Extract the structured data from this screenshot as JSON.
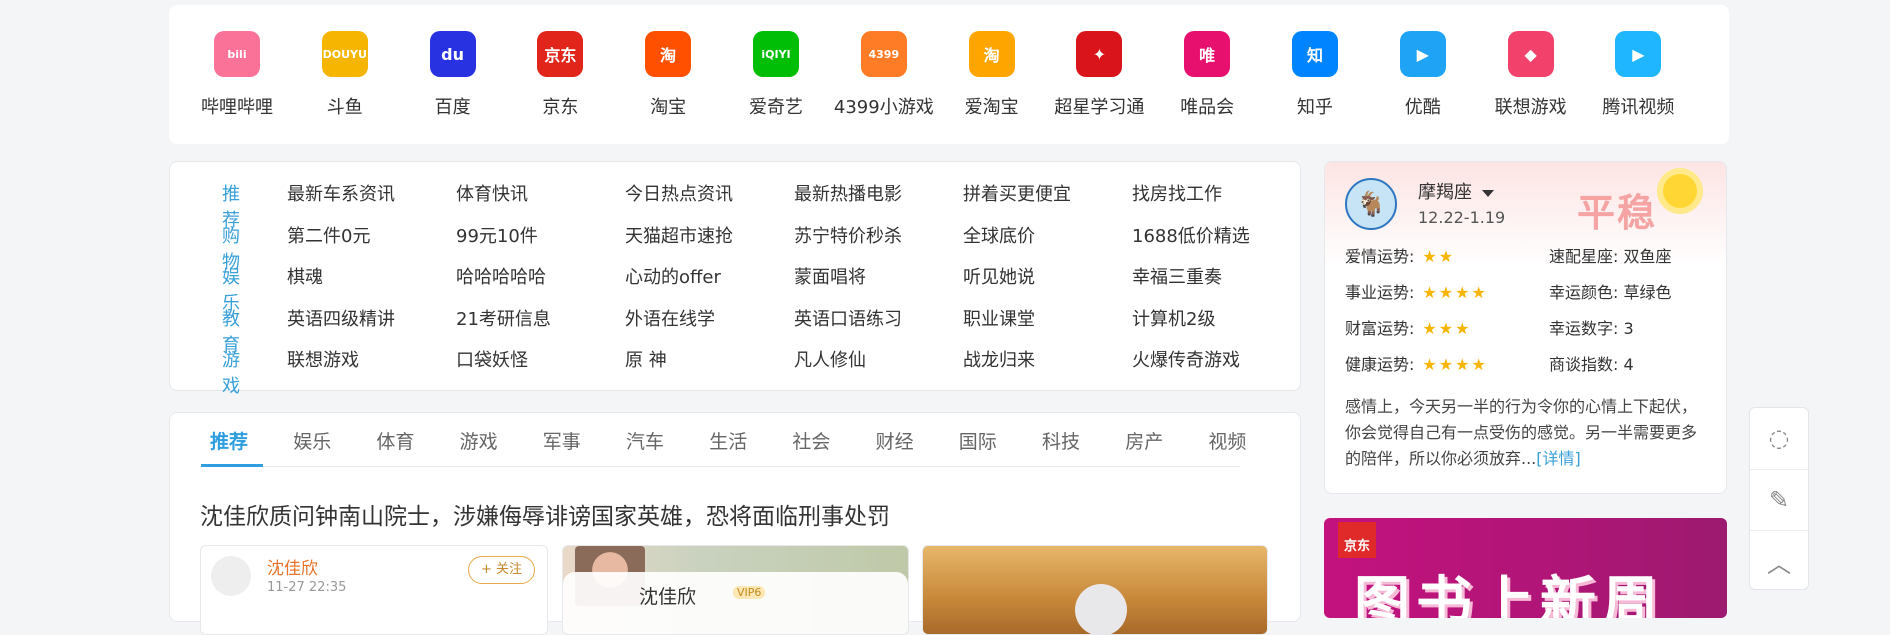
{
  "apps": [
    {
      "label": "哔哩哔哩",
      "icon": "bilibili-icon",
      "glyph": "bili",
      "color": "#fb7299"
    },
    {
      "label": "斗鱼",
      "icon": "douyu-icon",
      "glyph": "DOUYU",
      "color": "#f5b500"
    },
    {
      "label": "百度",
      "icon": "baidu-icon",
      "glyph": "du",
      "color": "#2932e1"
    },
    {
      "label": "京东",
      "icon": "jd-icon",
      "glyph": "京东",
      "color": "#e1251b"
    },
    {
      "label": "淘宝",
      "icon": "taobao-icon",
      "glyph": "淘",
      "color": "#ff5000"
    },
    {
      "label": "爱奇艺",
      "icon": "iqiyi-icon",
      "glyph": "iQIYI",
      "color": "#00be06"
    },
    {
      "label": "4399小游戏",
      "icon": "4399-icon",
      "glyph": "4399",
      "color": "#ff7c26"
    },
    {
      "label": "爱淘宝",
      "icon": "aitaobao-icon",
      "glyph": "淘",
      "color": "#ffa500"
    },
    {
      "label": "超星学习通",
      "icon": "chaoxing-icon",
      "glyph": "✦",
      "color": "#d9141a"
    },
    {
      "label": "唯品会",
      "icon": "vipshop-icon",
      "glyph": "唯",
      "color": "#e8106e"
    },
    {
      "label": "知乎",
      "icon": "zhihu-icon",
      "glyph": "知",
      "color": "#0084ff"
    },
    {
      "label": "优酷",
      "icon": "youku-icon",
      "glyph": "▶",
      "color": "#1fa3f4"
    },
    {
      "label": "联想游戏",
      "icon": "lenovo-game-icon",
      "glyph": "◆",
      "color": "#f2416b"
    },
    {
      "label": "腾讯视频",
      "icon": "tencent-video-icon",
      "glyph": "▶",
      "color": "#20b6ff"
    }
  ],
  "hot": [
    {
      "cat": "推荐",
      "items": [
        "最新车系资讯",
        "体育快讯",
        "今日热点资讯",
        "最新热播电影",
        "拼着买更便宜",
        "找房找工作"
      ]
    },
    {
      "cat": "购物",
      "items": [
        "第二件0元",
        "99元10件",
        "天猫超市速抢",
        "苏宁特价秒杀",
        "全球底价",
        "1688低价精选"
      ]
    },
    {
      "cat": "娱乐",
      "items": [
        "棋魂",
        "哈哈哈哈哈",
        "心动的offer",
        "蒙面唱将",
        "听见她说",
        "幸福三重奏"
      ]
    },
    {
      "cat": "教育",
      "items": [
        "英语四级精讲",
        "21考研信息",
        "外语在线学",
        "英语口语练习",
        "职业课堂",
        "计算机2级"
      ]
    },
    {
      "cat": "游戏",
      "items": [
        "联想游戏",
        "口袋妖怪",
        "原 神",
        "凡人修仙",
        "战龙归来",
        "火爆传奇游戏"
      ]
    }
  ],
  "horoscope": {
    "sign": "摩羯座",
    "dates": "12.22-1.19",
    "status": "平稳",
    "left": [
      {
        "label": "爱情运势:",
        "stars": "★★"
      },
      {
        "label": "事业运势:",
        "stars": "★★★★"
      },
      {
        "label": "财富运势:",
        "stars": "★★★"
      },
      {
        "label": "健康运势:",
        "stars": "★★★★"
      }
    ],
    "right": [
      {
        "text": "速配星座:  双鱼座"
      },
      {
        "text": "幸运颜色:  草绿色"
      },
      {
        "text": "幸运数字:  3"
      },
      {
        "text": "商谈指数:  4"
      }
    ],
    "desc": "感情上，今天另一半的行为令你的心情上下起伏，你会觉得自己有一点受伤的感觉。另一半需要更多的陪伴，所以你必须放弃...",
    "detail": "[详情]"
  },
  "news": {
    "tabs": [
      "推荐",
      "娱乐",
      "体育",
      "游戏",
      "军事",
      "汽车",
      "生活",
      "社会",
      "财经",
      "国际",
      "科技",
      "房产",
      "视频"
    ],
    "headline": "沈佳欣质问钟南山院士，涉嫌侮辱诽谤国家英雄，恐将面临刑事处罚",
    "card1": {
      "name": "沈佳欣",
      "time": "11-27 22:35",
      "follow": "+ 关注"
    },
    "card2": {
      "name": "沈佳欣",
      "vip": "VIP6"
    }
  },
  "ad": {
    "logo": "京东",
    "title": "图书上新周"
  }
}
